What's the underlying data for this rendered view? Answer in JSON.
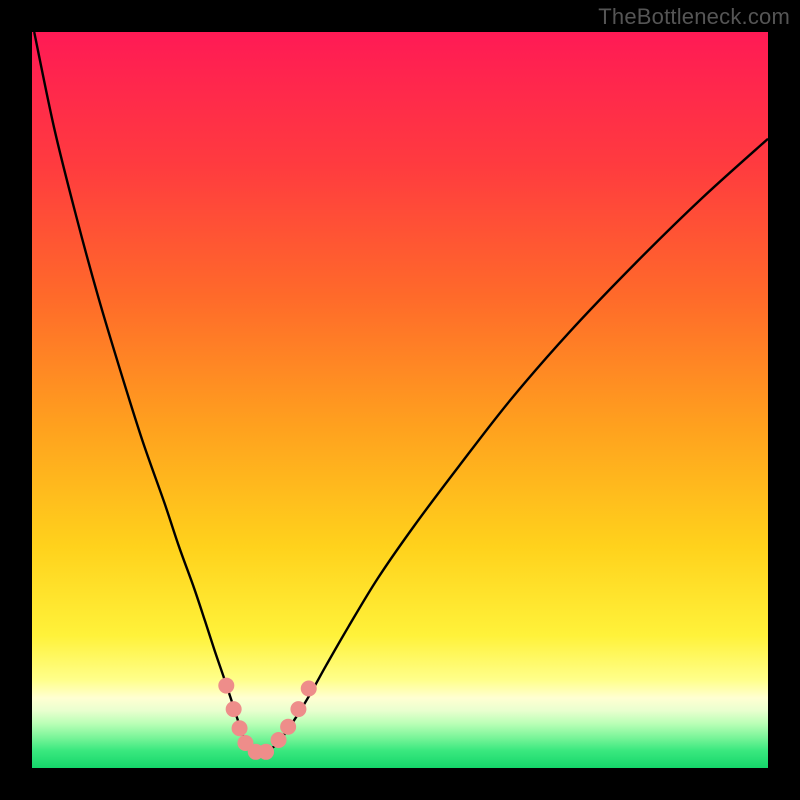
{
  "watermark": "TheBottleneck.com",
  "chart_data": {
    "type": "line",
    "title": "",
    "xlabel": "",
    "ylabel": "",
    "xlim": [
      0,
      100
    ],
    "ylim": [
      0,
      100
    ],
    "background_gradient_stops": [
      {
        "offset": 0.0,
        "color": "#ff1a55"
      },
      {
        "offset": 0.18,
        "color": "#ff3b3f"
      },
      {
        "offset": 0.36,
        "color": "#ff6a2a"
      },
      {
        "offset": 0.54,
        "color": "#ffa21e"
      },
      {
        "offset": 0.7,
        "color": "#ffd21c"
      },
      {
        "offset": 0.82,
        "color": "#fff23a"
      },
      {
        "offset": 0.88,
        "color": "#ffff8a"
      },
      {
        "offset": 0.905,
        "color": "#ffffd2"
      },
      {
        "offset": 0.922,
        "color": "#e9ffcf"
      },
      {
        "offset": 0.94,
        "color": "#b9ffb5"
      },
      {
        "offset": 0.958,
        "color": "#7cf59a"
      },
      {
        "offset": 0.976,
        "color": "#3be87f"
      },
      {
        "offset": 1.0,
        "color": "#14d66a"
      }
    ],
    "series": [
      {
        "name": "bottleneck-curve",
        "color": "#000000",
        "stroke_width": 2.4,
        "x": [
          0.3,
          3,
          6,
          9,
          12,
          15,
          18,
          20,
          22,
          23.5,
          24.8,
          26,
          27,
          27.8,
          28.4,
          28.9,
          29.4,
          30.2,
          31,
          31.8,
          33.2,
          34.6,
          36.2,
          38,
          40,
          43,
          47,
          52,
          58,
          65,
          73,
          82,
          91,
          100
        ],
        "y": [
          100,
          87,
          75,
          64,
          54,
          44.5,
          36,
          30,
          24.5,
          20,
          16,
          12.5,
          9.5,
          7,
          5.2,
          3.8,
          2.8,
          2.2,
          2.0,
          2.2,
          3.2,
          5.0,
          7.4,
          10.4,
          14,
          19.2,
          25.8,
          33,
          41,
          50,
          59.2,
          68.6,
          77.4,
          85.5
        ]
      }
    ],
    "markers": {
      "color": "#ee8d8a",
      "radius": 8,
      "points": [
        {
          "x": 26.4,
          "y": 11.2
        },
        {
          "x": 27.4,
          "y": 8.0
        },
        {
          "x": 28.2,
          "y": 5.4
        },
        {
          "x": 29.0,
          "y": 3.4
        },
        {
          "x": 30.4,
          "y": 2.2
        },
        {
          "x": 31.8,
          "y": 2.2
        },
        {
          "x": 33.5,
          "y": 3.8
        },
        {
          "x": 34.8,
          "y": 5.6
        },
        {
          "x": 36.2,
          "y": 8.0
        },
        {
          "x": 37.6,
          "y": 10.8
        }
      ]
    }
  }
}
